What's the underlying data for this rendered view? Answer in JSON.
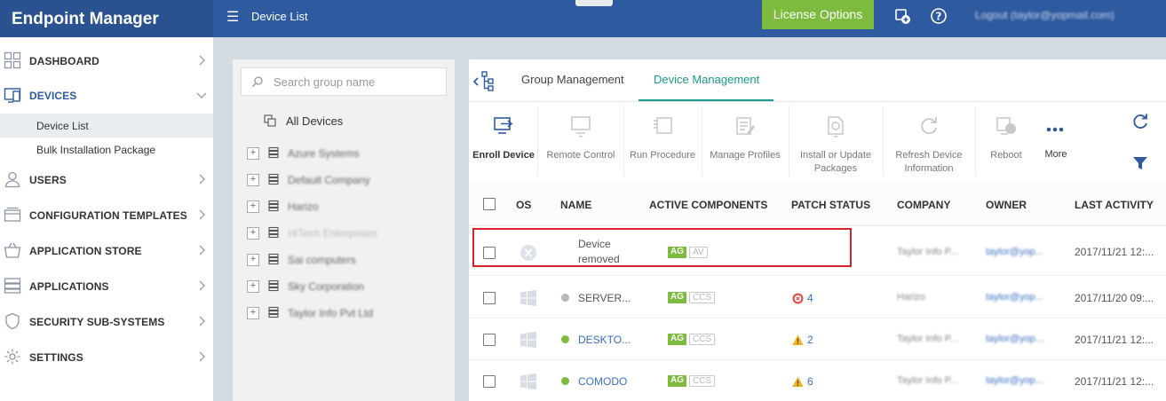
{
  "app": {
    "title": "Endpoint Manager",
    "breadcrumb": "Device List",
    "license_button": "License Options",
    "user_label": "Logout (taylor@yopmail.com)"
  },
  "colors": {
    "header": "#2e5a9f",
    "accent_green": "#7dbb3f",
    "tab_active": "#1a9a8a",
    "highlight": "#d8232a"
  },
  "sidebar": {
    "items": [
      {
        "label": "DASHBOARD",
        "icon": "dashboard-icon"
      },
      {
        "label": "DEVICES",
        "icon": "devices-icon",
        "expanded": true
      },
      {
        "label": "USERS",
        "icon": "user-icon"
      },
      {
        "label": "CONFIGURATION TEMPLATES",
        "icon": "templates-icon"
      },
      {
        "label": "APPLICATION STORE",
        "icon": "store-icon"
      },
      {
        "label": "APPLICATIONS",
        "icon": "applications-icon"
      },
      {
        "label": "SECURITY SUB-SYSTEMS",
        "icon": "shield-icon"
      },
      {
        "label": "SETTINGS",
        "icon": "gear-icon"
      }
    ],
    "sub_items": [
      {
        "label": "Device List",
        "selected": true
      },
      {
        "label": "Bulk Installation Package"
      }
    ]
  },
  "groups": {
    "search_placeholder": "Search group name",
    "all_devices": "All Devices",
    "items": [
      "Azure Systems",
      "Default Company",
      "Harizo",
      "HiTech Enterprises",
      "Sai computers",
      "Sky Corporation",
      "Taylor Info Pvt Ltd"
    ]
  },
  "tabs": [
    {
      "label": "Group Management",
      "active": false
    },
    {
      "label": "Device Management",
      "active": true
    }
  ],
  "toolbar": [
    {
      "label": "Enroll Device",
      "enabled": true,
      "icon": "enroll-device-icon"
    },
    {
      "label": "Remote Control",
      "enabled": false,
      "icon": "remote-control-icon"
    },
    {
      "label": "Run Procedure",
      "enabled": false,
      "icon": "run-procedure-icon"
    },
    {
      "label": "Manage Profiles",
      "enabled": false,
      "icon": "manage-profiles-icon"
    },
    {
      "label": "Install or Update Packages",
      "enabled": false,
      "icon": "install-packages-icon"
    },
    {
      "label": "Refresh Device Information",
      "enabled": false,
      "icon": "refresh-device-icon"
    },
    {
      "label": "Reboot",
      "enabled": false,
      "icon": "reboot-icon"
    },
    {
      "label": "More",
      "enabled": true,
      "icon": "more-icon"
    }
  ],
  "table": {
    "headers": [
      "OS",
      "NAME",
      "ACTIVE COMPONENTS",
      "PATCH STATUS",
      "COMPANY",
      "OWNER",
      "LAST ACTIVITY"
    ],
    "rows": [
      {
        "os": "unknown",
        "name_line1": "Device",
        "name_line2": "removed",
        "status": "none",
        "components": [
          "AG",
          "AV"
        ],
        "patch_count": "",
        "company": "Taylor Info P...",
        "owner": "taylor@yop...",
        "last_activity": "2017/11/21 12:..."
      },
      {
        "os": "windows",
        "name": "SERVER...",
        "status": "offline",
        "components": [
          "AG",
          "CCS"
        ],
        "patch_type": "error",
        "patch_count": "4",
        "company": "Harizo",
        "owner": "taylor@yop...",
        "last_activity": "2017/11/20 09:..."
      },
      {
        "os": "windows",
        "name": "DESKTO...",
        "status": "online",
        "components": [
          "AG",
          "CCS"
        ],
        "patch_type": "warning",
        "patch_count": "2",
        "company": "Taylor Info P...",
        "owner": "taylor@yop...",
        "last_activity": "2017/11/21 12:..."
      },
      {
        "os": "windows",
        "name": "COMODO",
        "status": "online",
        "components": [
          "AG",
          "CCS"
        ],
        "patch_type": "warning",
        "patch_count": "6",
        "company": "Taylor Info P...",
        "owner": "taylor@yop...",
        "last_activity": "2017/11/21 12:..."
      }
    ]
  }
}
